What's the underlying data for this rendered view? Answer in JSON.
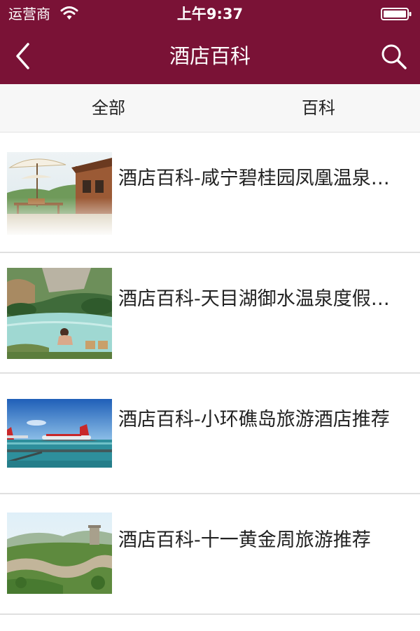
{
  "status_bar": {
    "carrier": "运营商",
    "time": "上午9:37",
    "wifi_icon": "wifi-icon",
    "battery_icon": "battery-icon"
  },
  "nav": {
    "title": "酒店百科",
    "back_icon": "chevron-left-icon",
    "search_icon": "search-icon",
    "bar_color": "#7a1236"
  },
  "tabs": [
    {
      "label": "全部"
    },
    {
      "label": "百科"
    }
  ],
  "articles": [
    {
      "title": "酒店百科-咸宁碧桂园凤凰温泉酒店",
      "image": "resort-umbrella-terrace-photo"
    },
    {
      "title": "酒店百科-天目湖御水温泉度假酒店",
      "image": "hot-spring-pool-photo"
    },
    {
      "title": "酒店百科-小环礁岛旅游酒店推荐",
      "image": "seaplane-pier-photo"
    },
    {
      "title": "酒店百科-十一黄金周旅游推荐",
      "image": "great-wall-photo"
    }
  ]
}
